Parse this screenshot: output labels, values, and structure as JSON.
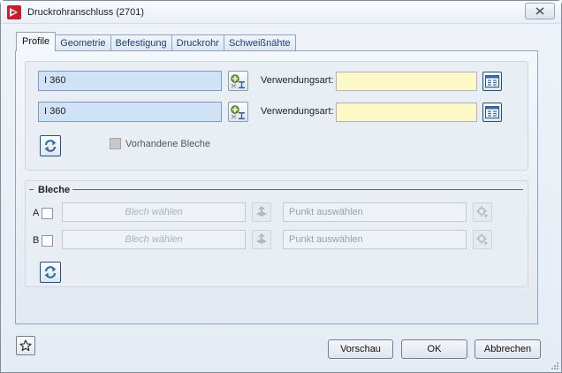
{
  "window": {
    "title": "Druckrohranschluss (2701)",
    "icons": {
      "app": "hicad-app-icon",
      "close": "close-icon"
    }
  },
  "tabs": [
    {
      "label": "Profile",
      "active": true
    },
    {
      "label": "Geometrie",
      "active": false
    },
    {
      "label": "Befestigung",
      "active": false
    },
    {
      "label": "Druckrohr",
      "active": false
    },
    {
      "label": "Schweißnähte",
      "active": false
    }
  ],
  "profiles": {
    "rows": [
      {
        "profile_value": "I 360",
        "usage_label": "Verwendungsart:",
        "usage_value": ""
      },
      {
        "profile_value": "I 360",
        "usage_label": "Verwendungsart:",
        "usage_value": ""
      }
    ],
    "existing_sheets_label": "Vorhandene Bleche",
    "existing_sheets_checked": false
  },
  "sheets": {
    "group_label": "Bleche",
    "rows": [
      {
        "letter": "A",
        "sheet_placeholder": "Blech wählen",
        "point_placeholder": "Punkt auswählen"
      },
      {
        "letter": "B",
        "sheet_placeholder": "Blech wählen",
        "point_placeholder": "Punkt auswählen"
      }
    ]
  },
  "footer": {
    "preview_label": "Vorschau",
    "ok_label": "OK",
    "cancel_label": "Abbrechen"
  },
  "colors": {
    "accent": "#1c3f75",
    "profile_field": "#cfe2f6",
    "usage_field": "#fcf9c6"
  }
}
